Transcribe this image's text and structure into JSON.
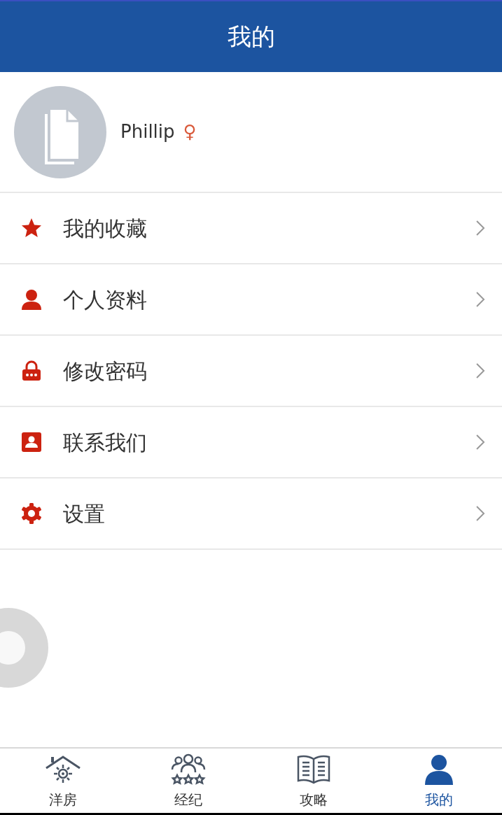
{
  "header": {
    "title": "我的"
  },
  "profile": {
    "name": "Phillip",
    "gender_symbol": "♀"
  },
  "menu": [
    {
      "kind": "star",
      "label": "我的收藏"
    },
    {
      "kind": "person",
      "label": "个人资料"
    },
    {
      "kind": "lock",
      "label": "修改密码"
    },
    {
      "kind": "contact",
      "label": "联系我们"
    },
    {
      "kind": "gear",
      "label": "设置"
    }
  ],
  "tab_bar": [
    {
      "kind": "house",
      "label": "洋房",
      "selected": false
    },
    {
      "kind": "agents",
      "label": "经纪",
      "selected": false
    },
    {
      "kind": "book",
      "label": "攻略",
      "selected": false
    },
    {
      "kind": "person",
      "label": "我的",
      "selected": true
    }
  ]
}
